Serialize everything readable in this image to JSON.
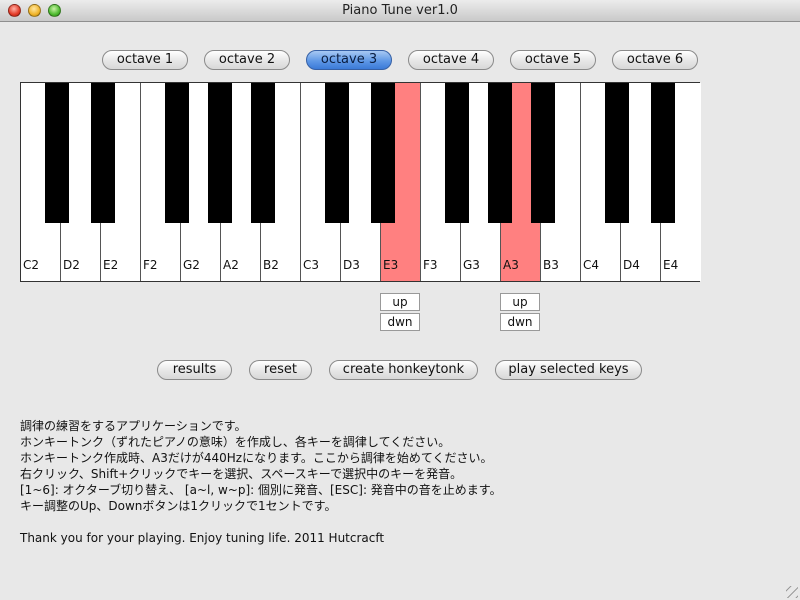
{
  "window": {
    "title": "Piano Tune ver1.0"
  },
  "octave_buttons": [
    {
      "label": "octave 1",
      "selected": false
    },
    {
      "label": "octave 2",
      "selected": false
    },
    {
      "label": "octave 3",
      "selected": true
    },
    {
      "label": "octave 4",
      "selected": false
    },
    {
      "label": "octave 5",
      "selected": false
    },
    {
      "label": "octave 6",
      "selected": false
    }
  ],
  "keyboard": {
    "selected_color": "#ff8080",
    "white_keys": [
      {
        "label": "C2",
        "selected": false
      },
      {
        "label": "D2",
        "selected": false
      },
      {
        "label": "E2",
        "selected": false
      },
      {
        "label": "F2",
        "selected": false
      },
      {
        "label": "G2",
        "selected": false
      },
      {
        "label": "A2",
        "selected": false
      },
      {
        "label": "B2",
        "selected": false
      },
      {
        "label": "C3",
        "selected": false
      },
      {
        "label": "D3",
        "selected": false
      },
      {
        "label": "E3",
        "selected": true
      },
      {
        "label": "F3",
        "selected": false
      },
      {
        "label": "G3",
        "selected": false
      },
      {
        "label": "A3",
        "selected": true
      },
      {
        "label": "B3",
        "selected": false
      },
      {
        "label": "C4",
        "selected": false
      },
      {
        "label": "D4",
        "selected": false
      },
      {
        "label": "E4",
        "selected": false
      }
    ],
    "black_keys": [
      {
        "selected": false
      },
      {
        "selected": false
      },
      {
        "selected": false
      },
      {
        "selected": false
      },
      {
        "selected": false
      },
      {
        "selected": false
      },
      {
        "selected": false
      },
      {
        "selected": false
      },
      {
        "selected": false
      },
      {
        "selected": false
      }
    ]
  },
  "tune_controls": [
    {
      "key": "E3",
      "up_label": "up",
      "down_label": "dwn"
    },
    {
      "key": "A3",
      "up_label": "up",
      "down_label": "dwn"
    }
  ],
  "actions": {
    "results": "results",
    "reset": "reset",
    "create": "create honkeytonk",
    "play": "play selected keys"
  },
  "description": [
    "調律の練習をするアプリケーションです。",
    "ホンキートンク（ずれたピアノの意味）を作成し、各キーを調律してください。",
    "ホンキートンク作成時、A3だけが440Hzになります。ここから調律を始めてください。",
    "右クリック、Shift+クリックでキーを選択、スペースキーで選択中のキーを発音。",
    "[1~6]: オクターブ切り替え、 [a~l, w~p]: 個別に発音、[ESC]: 発音中の音を止めます。",
    "キー調整のUp、Downボタンは1クリックで1セントです。"
  ],
  "footer": "Thank you for your playing. Enjoy tuning life. 2011 Hutcracft"
}
